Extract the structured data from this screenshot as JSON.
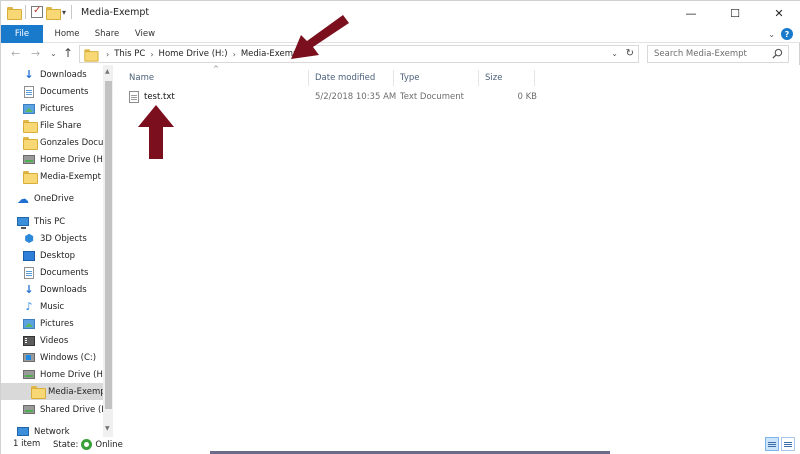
{
  "window": {
    "title": "Media-Exempt",
    "controls": {
      "minimize": "—",
      "maximize": "☐",
      "close": "✕"
    }
  },
  "ribbon": {
    "tabs": [
      "File",
      "Home",
      "Share",
      "View"
    ]
  },
  "address": {
    "crumbs": [
      "This PC",
      "Home Drive (H:)",
      "Media-Exempt"
    ],
    "search_placeholder": "Search Media-Exempt"
  },
  "nav_pane": {
    "items": [
      {
        "label": "Downloads",
        "icon": "download-icon",
        "pinned": true
      },
      {
        "label": "Documents",
        "icon": "document-icon",
        "pinned": true
      },
      {
        "label": "Pictures",
        "icon": "pictures-icon",
        "pinned": true
      },
      {
        "label": "File Share",
        "icon": "folder-icon",
        "pinned": false
      },
      {
        "label": "Gonzales Documents",
        "icon": "folder-icon",
        "pinned": false
      },
      {
        "label": "Home Drive (H:)",
        "icon": "network-drive-icon",
        "pinned": false
      },
      {
        "label": "Media-Exempt",
        "icon": "folder-icon",
        "pinned": false
      },
      {
        "label": "OneDrive",
        "icon": "onedrive-icon",
        "pinned": false
      },
      {
        "label": "This PC",
        "icon": "this-pc-icon",
        "pinned": false
      },
      {
        "label": "3D Objects",
        "icon": "3d-objects-icon",
        "pinned": false
      },
      {
        "label": "Desktop",
        "icon": "desktop-icon",
        "pinned": false
      },
      {
        "label": "Documents",
        "icon": "document-icon",
        "pinned": false
      },
      {
        "label": "Downloads",
        "icon": "download-icon",
        "pinned": false
      },
      {
        "label": "Music",
        "icon": "music-icon",
        "pinned": false
      },
      {
        "label": "Pictures",
        "icon": "pictures-icon",
        "pinned": false
      },
      {
        "label": "Videos",
        "icon": "videos-icon",
        "pinned": false
      },
      {
        "label": "Windows (C:)",
        "icon": "windows-drive-icon",
        "pinned": false
      },
      {
        "label": "Home Drive (H:)",
        "icon": "network-drive-icon",
        "pinned": false
      },
      {
        "label": "Media-Exempt",
        "icon": "folder-icon",
        "pinned": false,
        "selected": true
      },
      {
        "label": "Shared Drive (I:)",
        "icon": "network-drive-icon",
        "pinned": false
      },
      {
        "label": "Network",
        "icon": "network-icon",
        "pinned": false
      }
    ]
  },
  "file_list": {
    "columns": [
      "Name",
      "Date modified",
      "Type",
      "Size"
    ],
    "rows": [
      {
        "name": "test.txt",
        "date": "5/2/2018 10:35 AM",
        "type": "Text Document",
        "size": "0 KB"
      }
    ]
  },
  "status_bar": {
    "count": "1 item",
    "state_label": "State:",
    "state_value": "Online"
  },
  "colors": {
    "accent": "#1979ca",
    "annotation_arrow": "#7b0f1e"
  }
}
